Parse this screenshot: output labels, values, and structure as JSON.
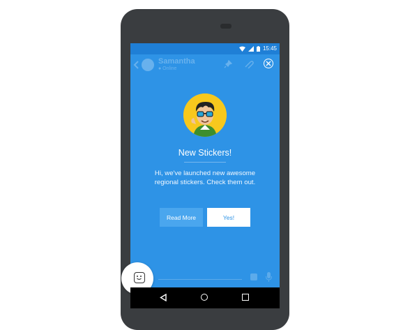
{
  "statusbar": {
    "time": "15:45"
  },
  "appbar": {
    "chat_title": "Samantha",
    "chat_subtitle": "● Online"
  },
  "popup": {
    "title": "New Stickers!",
    "message": "Hi, we've launched new awesome regional stickers. Check them out.",
    "read_more_label": "Read More",
    "yes_label": "Yes!"
  },
  "colors": {
    "screen_bg": "#2e93e6",
    "statusbar_bg": "#1f7fd6",
    "read_more_bg": "#4aa6ee",
    "yes_bg": "#ffffff",
    "avatar_bg": "#f7c81d",
    "phone_body": "#3a3d40"
  },
  "icons": [
    "wifi-icon",
    "signal-icon",
    "battery-icon",
    "back-chevron-icon",
    "pin-icon",
    "attach-icon",
    "close-icon",
    "sticker-icon",
    "mic-icon",
    "nav-back-icon",
    "nav-home-icon",
    "nav-recent-icon"
  ]
}
